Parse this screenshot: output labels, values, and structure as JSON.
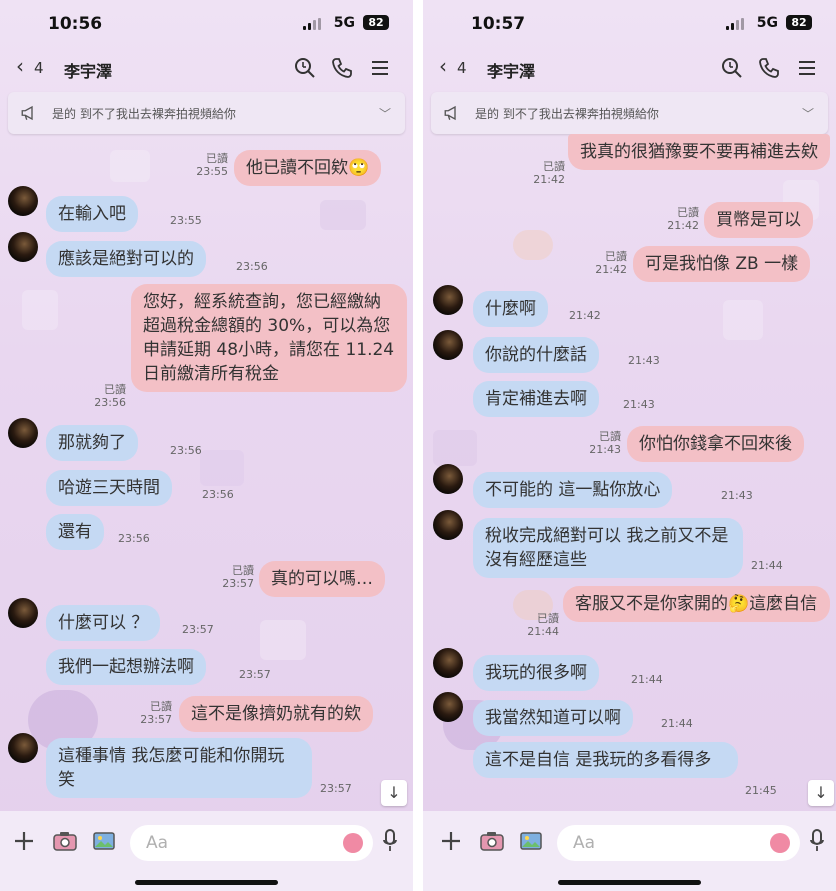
{
  "left": {
    "status": {
      "time": "10:56",
      "network": "5G",
      "battery": "82"
    },
    "header": {
      "back_count": "4",
      "name": "李宇澤"
    },
    "pinned": "是的 到不了我出去裸奔拍視頻給你",
    "input_placeholder": "Aa",
    "messages": [
      {
        "dir": "out",
        "text": "他已讀不回欸🙄",
        "read": "已讀",
        "time": "23:55"
      },
      {
        "dir": "in",
        "text": "在輸入吧",
        "time": "23:55"
      },
      {
        "dir": "in",
        "text": "應該是絕對可以的",
        "time": "23:56"
      },
      {
        "dir": "out",
        "text": "您好，經系統查詢，您已經繳納超過稅金總額的 30%，可以為您申請延期 48小時，請您在 11.24日前繳清所有稅金",
        "read": "已讀",
        "time": "23:56"
      },
      {
        "dir": "in",
        "text": "那就夠了",
        "time": "23:56"
      },
      {
        "dir": "in",
        "text": "哈遊三天時間",
        "time": "23:56"
      },
      {
        "dir": "in",
        "text": "還有",
        "time": "23:56"
      },
      {
        "dir": "out",
        "text": "真的可以嗎…",
        "read": "已讀",
        "time": "23:57"
      },
      {
        "dir": "in",
        "text": "什麼可以 ？",
        "time": "23:57"
      },
      {
        "dir": "in",
        "text": "我們一起想辦法啊",
        "time": "23:57"
      },
      {
        "dir": "out",
        "text": "這不是像擠奶就有的欸",
        "read": "已讀",
        "time": "23:57"
      },
      {
        "dir": "in",
        "text": "這種事情 我怎麼可能和你開玩笑",
        "time": "23:57"
      }
    ]
  },
  "right": {
    "status": {
      "time": "10:57",
      "network": "5G",
      "battery": "82"
    },
    "header": {
      "back_count": "4",
      "name": "李宇澤"
    },
    "pinned": "是的 到不了我出去裸奔拍視頻給你",
    "input_placeholder": "Aa",
    "messages": [
      {
        "dir": "out",
        "text": "我真的很猶豫要不要再補進去欸",
        "read": "已讀",
        "time": "21:42"
      },
      {
        "dir": "out",
        "text": "買幣是可以",
        "read": "已讀",
        "time": "21:42"
      },
      {
        "dir": "out",
        "text": "可是我怕像 ZB 一樣",
        "read": "已讀",
        "time": "21:42"
      },
      {
        "dir": "in",
        "text": "什麼啊",
        "time": "21:42"
      },
      {
        "dir": "in",
        "text": "你說的什麼話",
        "time": "21:43"
      },
      {
        "dir": "in",
        "text": "肯定補進去啊",
        "time": "21:43"
      },
      {
        "dir": "out",
        "text": "你怕你錢拿不回來後",
        "read": "已讀",
        "time": "21:43"
      },
      {
        "dir": "in",
        "text": "不可能的 這一點你放心",
        "time": "21:43"
      },
      {
        "dir": "in",
        "text": "稅收完成絕對可以 我之前又不是沒有經歷這些",
        "time": "21:44"
      },
      {
        "dir": "out",
        "text": "客服又不是你家開的🤔這麼自信",
        "read": "已讀",
        "time": "21:44"
      },
      {
        "dir": "in",
        "text": "我玩的很多啊",
        "time": "21:44"
      },
      {
        "dir": "in",
        "text": "我當然知道可以啊",
        "time": "21:44"
      },
      {
        "dir": "in",
        "text": "這不是自信 是我玩的多看得多",
        "time": "21:45"
      }
    ]
  },
  "icons": [
    "search-icon",
    "phone-icon",
    "menu-icon",
    "megaphone-icon",
    "chevron-down-icon",
    "plus-icon",
    "camera-icon",
    "image-icon",
    "emoji-icon",
    "mic-icon",
    "arrow-down-icon"
  ]
}
